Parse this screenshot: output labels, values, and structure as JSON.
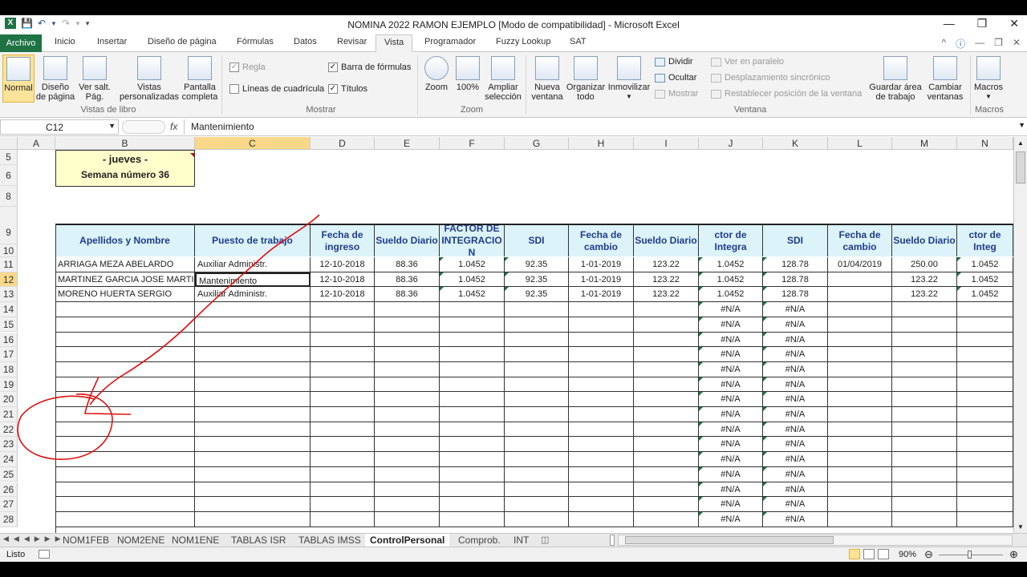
{
  "window": {
    "title": "NOMINA 2022 RAMON EJEMPLO  [Modo de compatibilidad]  -  Microsoft Excel"
  },
  "ribbon_tabs": [
    "Archivo",
    "Inicio",
    "Insertar",
    "Diseño de página",
    "Fórmulas",
    "Datos",
    "Revisar",
    "Vista",
    "Programador",
    "Fuzzy Lookup",
    "SAT"
  ],
  "ribbon": {
    "libro": {
      "normal": "Normal",
      "diseno_l1": "Diseño",
      "diseno_l2": "de página",
      "versalt_l1": "Ver salt.",
      "versalt_l2": "Pág.",
      "vistas_l1": "Vistas",
      "vistas_l2": "personalizadas",
      "pantalla_l1": "Pantalla",
      "pantalla_l2": "completa",
      "group": "Vistas de libro"
    },
    "mostrar": {
      "regla": "Regla",
      "barra": "Barra de fórmulas",
      "lineas": "Líneas de cuadrícula",
      "titulos": "Títulos",
      "group": "Mostrar"
    },
    "zoom": {
      "zoom": "Zoom",
      "cien": "100%",
      "ampliar_l1": "Ampliar",
      "ampliar_l2": "selección",
      "group": "Zoom"
    },
    "ventana": {
      "nueva_l1": "Nueva",
      "nueva_l2": "ventana",
      "organizar_l1": "Organizar",
      "organizar_l2": "todo",
      "inmovilizar": "Inmovilizar",
      "dividir": "Dividir",
      "ocultar": "Ocultar",
      "mostrar": "Mostrar",
      "paralelo": "Ver en paralelo",
      "desplazamiento": "Desplazamiento sincrónico",
      "restablecer": "Restablecer posición de la ventana",
      "guardar_l1": "Guardar área",
      "guardar_l2": "de trabajo",
      "cambiar_l1": "Cambiar",
      "cambiar_l2": "ventanas",
      "group": "Ventana"
    },
    "macros": {
      "macros": "Macros",
      "group": "Macros"
    }
  },
  "formula_bar": {
    "name_box": "C12",
    "fx": "fx",
    "content": "Mantenimiento"
  },
  "columns": [
    "A",
    "B",
    "C",
    "D",
    "E",
    "F",
    "G",
    "H",
    "I",
    "J",
    "K",
    "L",
    "M",
    "N"
  ],
  "rows": [
    "5",
    "6",
    "8",
    "9",
    "10",
    "11",
    "12",
    "13",
    "14",
    "15",
    "16",
    "17",
    "18",
    "19",
    "20",
    "21",
    "22",
    "23",
    "24",
    "25",
    "26",
    "27",
    "28"
  ],
  "banner": {
    "day": "- jueves -",
    "week": "Semana número  36"
  },
  "table_headers": {
    "b": "Apellidos y Nombre",
    "c": "Puesto de trabajo",
    "d": "Fecha de ingreso",
    "e": "Sueldo Diario",
    "f": "FACTOR DE INTEGRACIO N",
    "g": "SDI",
    "h": "Fecha de cambio",
    "i": "Sueldo Diario",
    "j": "ctor de Integra",
    "k": "SDI",
    "l": "Fecha de cambio",
    "m": "Sueldo Diario",
    "n": "ctor de Integ"
  },
  "records": [
    {
      "b": "ARRIAGA MEZA ABELARDO",
      "c": "Auxiliar Administr.",
      "d": "12-10-2018",
      "e": "88.36",
      "f": "1.0452",
      "g": "92.35",
      "h": "1-01-2019",
      "i": "123.22",
      "j": "1.0452",
      "k": "128.78",
      "l": "01/04/2019",
      "m": "250.00",
      "n": "1.0452"
    },
    {
      "b": "MARTINEZ GARCIA JOSE MARTIN",
      "c": "Mantenimiento",
      "d": "12-10-2018",
      "e": "88.36",
      "f": "1.0452",
      "g": "92.35",
      "h": "1-01-2019",
      "i": "123.22",
      "j": "1.0452",
      "k": "128.78",
      "l": "",
      "m": "123.22",
      "n": "1.0452"
    },
    {
      "b": "MORENO HUERTA SERGIO",
      "c": "Auxiliar Administr.",
      "d": "12-10-2018",
      "e": "88.36",
      "f": "1.0452",
      "g": "92.35",
      "h": "1-01-2019",
      "i": "123.22",
      "j": "1.0452",
      "k": "128.78",
      "l": "",
      "m": "123.22",
      "n": "1.0452"
    }
  ],
  "na_value": "#N/A",
  "sheet_tabs": [
    "NOM1FEB",
    "NOM2ENE",
    "NOM1ENE",
    "TABLAS ISR",
    "TABLAS IMSS",
    "ControlPersonal",
    "Comprob.",
    "INT"
  ],
  "active_sheet": "ControlPersonal",
  "status": {
    "ready": "Listo",
    "zoom": "90%"
  },
  "colors": {
    "excel_green": "#1f7244",
    "header_fill": "#dcf3fa",
    "header_text": "#1f3c8c",
    "banner_fill": "#ffffcc",
    "annotation_red": "#e01010"
  }
}
